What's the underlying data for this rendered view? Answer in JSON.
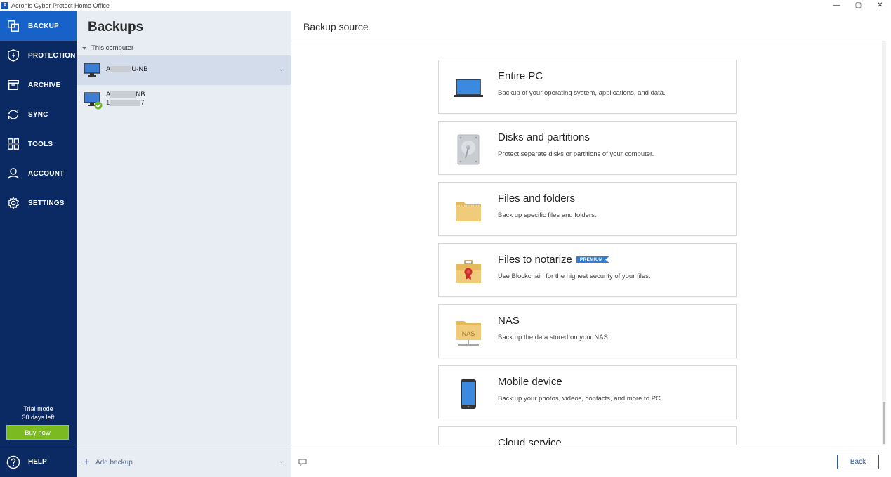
{
  "window": {
    "title": "Acronis Cyber Protect Home Office",
    "controls": [
      "—",
      "▢",
      "✕"
    ]
  },
  "nav": {
    "items": [
      {
        "label": "BACKUP",
        "icon": "backup-icon",
        "active": true
      },
      {
        "label": "PROTECTION",
        "icon": "shield-icon",
        "active": false
      },
      {
        "label": "ARCHIVE",
        "icon": "archive-icon",
        "active": false
      },
      {
        "label": "SYNC",
        "icon": "sync-icon",
        "active": false
      },
      {
        "label": "TOOLS",
        "icon": "tools-grid-icon",
        "active": false
      },
      {
        "label": "ACCOUNT",
        "icon": "account-icon",
        "active": false
      },
      {
        "label": "SETTINGS",
        "icon": "gear-icon",
        "active": false
      }
    ],
    "trial_line1": "Trial mode",
    "trial_line2": "30 days left",
    "buy_label": "Buy now",
    "help_label": "HELP"
  },
  "backups": {
    "title": "Backups",
    "group_label": "This computer",
    "items": [
      {
        "name_start": "A",
        "name_end": "U-NB",
        "selected": true
      },
      {
        "name_start": "A",
        "name_end": "NB",
        "sub_start": "1",
        "sub_end": "7",
        "status": "ok"
      }
    ],
    "add_label": "Add backup"
  },
  "source": {
    "title": "Backup source",
    "cards": [
      {
        "title": "Entire PC",
        "desc": "Backup of your operating system, applications, and data.",
        "icon": "laptop-icon"
      },
      {
        "title": "Disks and partitions",
        "desc": "Protect separate disks or partitions of your computer.",
        "icon": "disk-icon"
      },
      {
        "title": "Files and folders",
        "desc": "Back up specific files and folders.",
        "icon": "folder-icon"
      },
      {
        "title": "Files to notarize",
        "badge": "PREMIUM",
        "desc": "Use Blockchain for the highest security of your files.",
        "icon": "notarize-icon"
      },
      {
        "title": "NAS",
        "desc": "Back up the data stored on your NAS.",
        "icon": "nas-icon",
        "icon_text": "NAS"
      },
      {
        "title": "Mobile device",
        "desc": "Back up your photos, videos, contacts, and more to PC.",
        "icon": "mobile-icon"
      },
      {
        "title": "Cloud service",
        "desc": "",
        "icon": "cloud-icon"
      }
    ],
    "back_label": "Back"
  },
  "colors": {
    "nav_bg": "#0b2a63",
    "nav_active": "#1762c8",
    "buy_green": "#7cbb1f",
    "premium_blue": "#2f7fd6"
  }
}
